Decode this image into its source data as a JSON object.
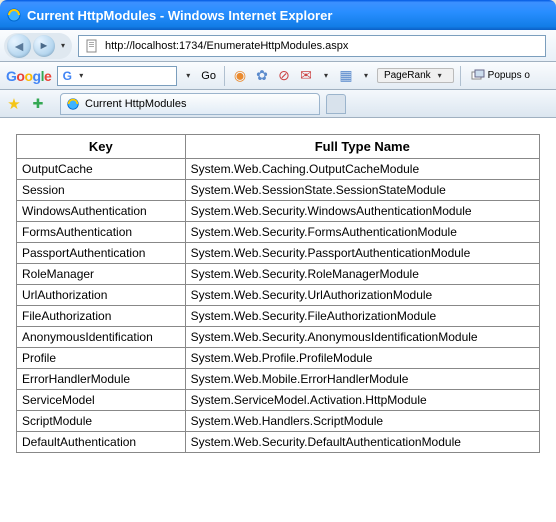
{
  "window": {
    "title": "Current HttpModules - Windows Internet Explorer"
  },
  "address": {
    "url": "http://localhost:1734/EnumerateHttpModules.aspx"
  },
  "google_toolbar": {
    "go_label": "Go",
    "pagerank_label": "PageRank",
    "popups_label": "Popups o"
  },
  "tab": {
    "title": "Current HttpModules"
  },
  "table": {
    "headers": [
      "Key",
      "Full Type Name"
    ],
    "rows": [
      [
        "OutputCache",
        "System.Web.Caching.OutputCacheModule"
      ],
      [
        "Session",
        "System.Web.SessionState.SessionStateModule"
      ],
      [
        "WindowsAuthentication",
        "System.Web.Security.WindowsAuthenticationModule"
      ],
      [
        "FormsAuthentication",
        "System.Web.Security.FormsAuthenticationModule"
      ],
      [
        "PassportAuthentication",
        "System.Web.Security.PassportAuthenticationModule"
      ],
      [
        "RoleManager",
        "System.Web.Security.RoleManagerModule"
      ],
      [
        "UrlAuthorization",
        "System.Web.Security.UrlAuthorizationModule"
      ],
      [
        "FileAuthorization",
        "System.Web.Security.FileAuthorizationModule"
      ],
      [
        "AnonymousIdentification",
        "System.Web.Security.AnonymousIdentificationModule"
      ],
      [
        "Profile",
        "System.Web.Profile.ProfileModule"
      ],
      [
        "ErrorHandlerModule",
        "System.Web.Mobile.ErrorHandlerModule"
      ],
      [
        "ServiceModel",
        "System.ServiceModel.Activation.HttpModule"
      ],
      [
        "ScriptModule",
        "System.Web.Handlers.ScriptModule"
      ],
      [
        "DefaultAuthentication",
        "System.Web.Security.DefaultAuthenticationModule"
      ]
    ]
  }
}
